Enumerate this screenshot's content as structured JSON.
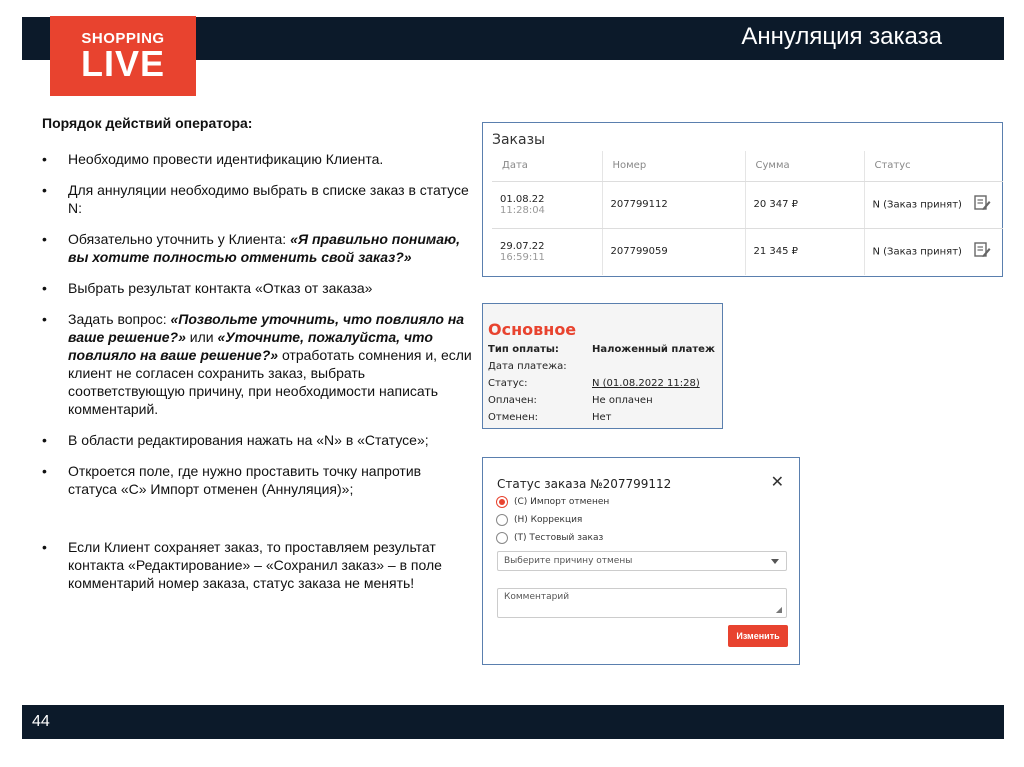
{
  "header": {
    "title": "Аннуляция заказа",
    "logo_line1": "SHOPPING",
    "logo_line2": "LIVE"
  },
  "footer": {
    "page_number": "44"
  },
  "instructions": {
    "heading": "Порядок действий оператора:",
    "bullets": [
      "Необходимо провести идентификацию Клиента.",
      "Для аннуляции необходимо выбрать в списке заказ в статусе N:",
      "Обязательно уточнить у Клиента: «Я правильно понимаю, вы хотите полностью отменить свой заказ?»",
      "Выбрать результат контакта «Отказ от заказа»",
      "Задать вопрос: «Позвольте уточнить, что повлияло на ваше решение?» или «Уточните, пожалуйста, что повлияло на ваше решение?» отработать сомнения и, если клиент не согласен сохранить заказ, выбрать соответствующую причину, при необходимости написать комментарий.",
      "В области редактирования нажать на «N» в «Статусе»;",
      "Откроется поле, где нужно проставить точку напротив статуса «С» Импорт отменен (Аннуляция)»;",
      "Если Клиент сохраняет заказ, то проставляем результат контакта «Редактирование» – «Сохранил заказ» – в поле комментарий номер заказа, статус заказа не менять!"
    ],
    "b3_plain": "Обязательно уточнить у Клиента: ",
    "b3_italic": "«Я правильно понимаю, вы хотите полностью отменить свой заказ?»",
    "b5_plain1": "Задать вопрос: ",
    "b5_italic1": "«Позвольте уточнить, что повлияло на ваше решение?»",
    "b5_plain2": " или ",
    "b5_italic2": "«Уточните, пожалуйста, что повлияло на ваше решение?»",
    "b5_plain3": " отработать сомнения и, если клиент не согласен сохранить заказ, выбрать соответствующую причину, при необходимости написать комментарий."
  },
  "orders": {
    "title": "Заказы",
    "columns": [
      "Дата",
      "Номер",
      "Сумма",
      "Статус"
    ],
    "rows": [
      {
        "date": "01.08.22",
        "time": "11:28:04",
        "number": "207799112",
        "sum": "20 347 ₽",
        "status": "N (Заказ принят)"
      },
      {
        "date": "29.07.22",
        "time": "16:59:11",
        "number": "207799059",
        "sum": "21 345 ₽",
        "status": "N (Заказ принят)"
      }
    ]
  },
  "main_info": {
    "title": "Основное",
    "rows": [
      {
        "key": "Тип оплаты:",
        "value": "Наложенный платеж"
      },
      {
        "key": "Дата платежа:",
        "value": ""
      },
      {
        "key": "Статус:",
        "value": "N (01.08.2022 11:28)"
      },
      {
        "key": "Оплачен:",
        "value": "Не оплачен"
      },
      {
        "key": "Отменен:",
        "value": "Нет"
      }
    ]
  },
  "dialog": {
    "title": "Статус заказа №207799112",
    "close": "✕",
    "options": [
      {
        "label": "(С) Импорт отменен",
        "checked": true
      },
      {
        "label": "(Н) Коррекция",
        "checked": false
      },
      {
        "label": "(Т) Тестовый заказ",
        "checked": false
      }
    ],
    "reason_placeholder": "Выберите причину отмены",
    "comment_placeholder": "Комментарий",
    "submit_label": "Изменить"
  },
  "colors": {
    "dark_bar": "#0c1a2a",
    "brand_red": "#e8432f",
    "panel_border": "#5a7fae"
  }
}
